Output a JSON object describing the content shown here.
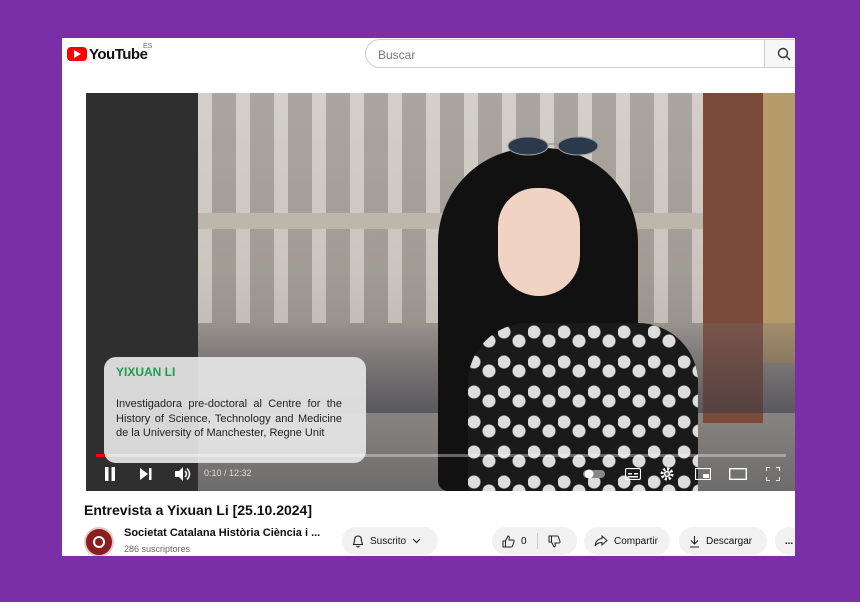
{
  "header": {
    "logo_text": "YouTube",
    "region": "ES",
    "search_placeholder": "Buscar"
  },
  "video": {
    "overlay": {
      "name": "YIXUAN LI",
      "role": "Investigadora pre-doctoral al Centre for the History of Science, Technology and Medicine de la University of Manchester, Regne Unit"
    },
    "time": "0:10 / 12:32",
    "progress_fraction": 0.013
  },
  "details": {
    "title": "Entrevista a Yixuan Li [25.10.2024]",
    "channel_name": "Societat Catalana Història Ciència i ...",
    "subscribers": "286 suscriptores",
    "subscribe_label": "Suscrito",
    "likes": "0",
    "share_label": "Compartir",
    "download_label": "Descargar",
    "more_label": "..."
  },
  "colors": {
    "page_bg": "#7b2fa6",
    "brand_red": "#ff0000",
    "name_green": "#1e9e4a"
  },
  "icons": [
    "search-icon",
    "pause-icon",
    "next-icon",
    "volume-icon",
    "autoplay-toggle-icon",
    "subtitles-icon",
    "settings-icon",
    "miniplayer-icon",
    "theater-icon",
    "fullscreen-icon",
    "bell-icon",
    "chevron-down-icon",
    "thumbs-up-icon",
    "thumbs-down-icon",
    "share-icon",
    "download-icon",
    "more-icon"
  ]
}
